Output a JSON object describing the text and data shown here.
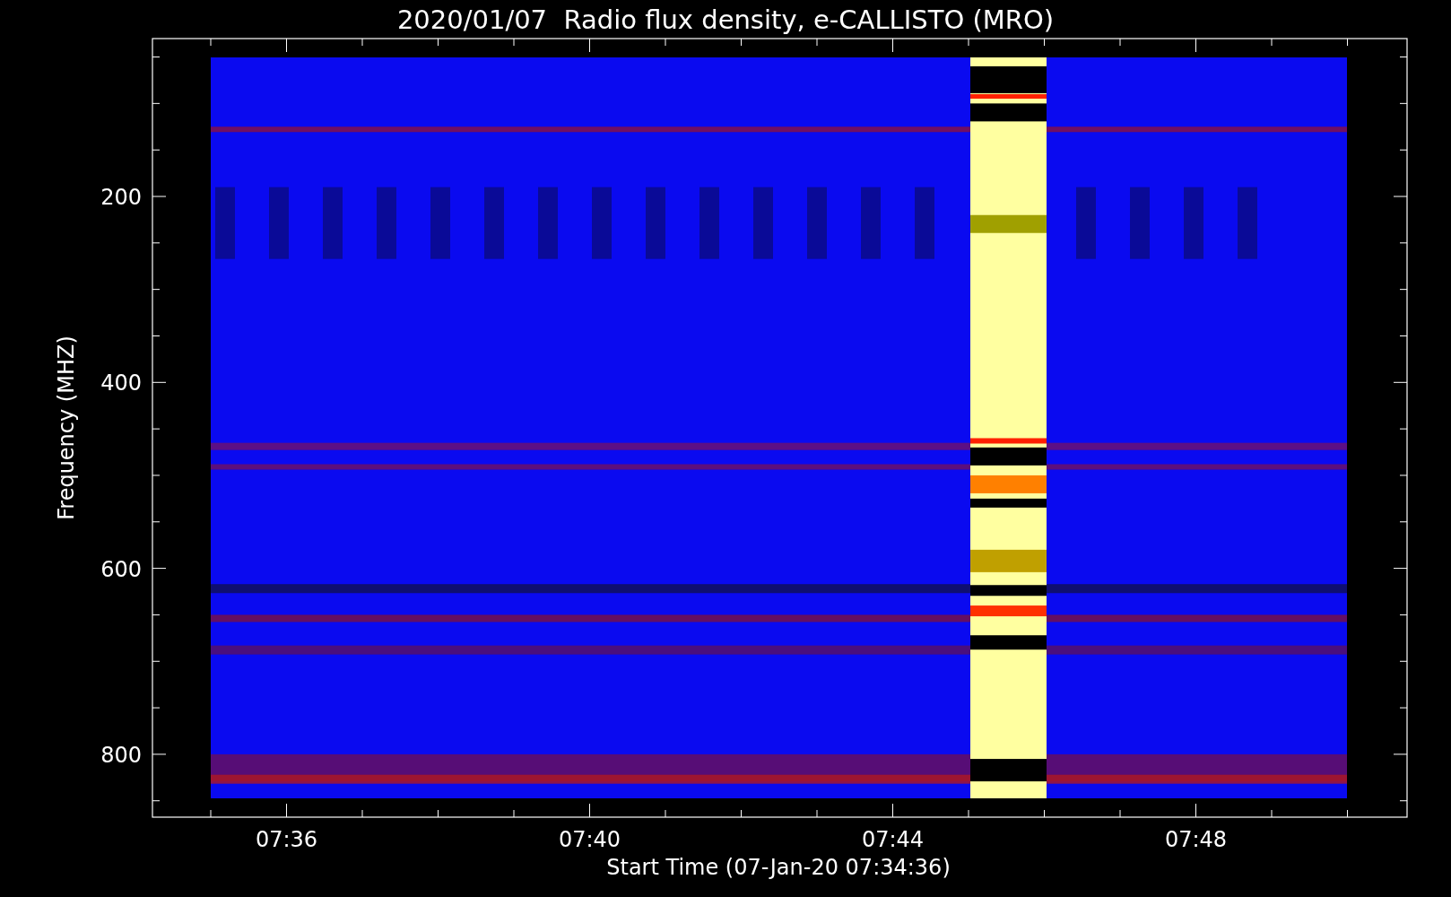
{
  "title": "2020/01/07  Radio flux density, e-CALLISTO (MRO)",
  "ylabel": "Frequency (MHZ)",
  "yticks": [
    "200",
    "400",
    "600",
    "800"
  ],
  "xticks": [
    "07:36",
    "07:40",
    "07:44",
    "07:48"
  ],
  "xlabel": "Start Time (07-Jan-20 07:34:36)"
}
